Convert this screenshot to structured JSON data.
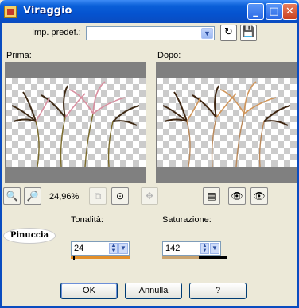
{
  "window": {
    "title": "Viraggio",
    "minimize_glyph": "_",
    "maximize_glyph": "□",
    "close_glyph": "✕"
  },
  "presets": {
    "label": "Imp. predef.:",
    "value": ""
  },
  "before": {
    "label": "Prima:"
  },
  "after": {
    "label": "Dopo:"
  },
  "zoom": {
    "value": "24,96%"
  },
  "hue": {
    "label": "Tonalità:",
    "value": "24",
    "level": 0.04,
    "bar_color": "#e38f2a"
  },
  "saturation": {
    "label": "Saturazione:",
    "value": "142",
    "level": 0.56,
    "bar_color": "#c9a36f"
  },
  "logo_text": "Pinuccia",
  "buttons": {
    "ok": "OK",
    "cancel": "Annulla",
    "help": "?"
  },
  "icons": [
    "app-icon",
    "dropdown-arrow-icon",
    "reset-icon",
    "save-icon",
    "zoom-out-icon",
    "zoom-in-icon",
    "fit-icon",
    "zoom-100-icon",
    "pan-icon",
    "compare-icon",
    "eye-lock-icon",
    "eye-icon"
  ]
}
